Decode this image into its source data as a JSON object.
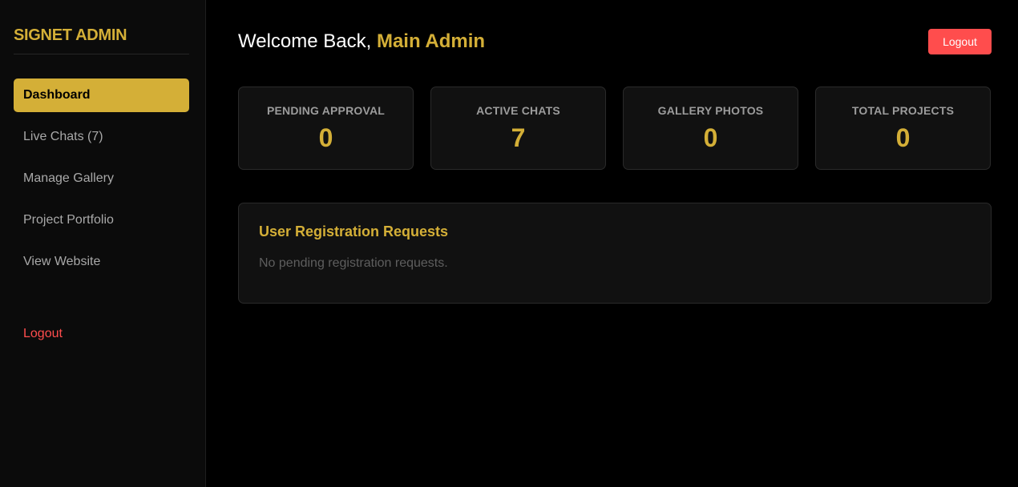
{
  "sidebar": {
    "brand": "SIGNET ADMIN",
    "items": [
      {
        "label": "Dashboard"
      },
      {
        "label": "Live Chats (7)"
      },
      {
        "label": "Manage Gallery"
      },
      {
        "label": "Project Portfolio"
      },
      {
        "label": "View Website"
      }
    ],
    "logout_label": "Logout"
  },
  "header": {
    "welcome_prefix": "Welcome Back,",
    "user_name": "Main Admin",
    "logout_label": "Logout"
  },
  "stats": [
    {
      "label": "PENDING APPROVAL",
      "value": "0"
    },
    {
      "label": "ACTIVE CHATS",
      "value": "7"
    },
    {
      "label": "GALLERY PHOTOS",
      "value": "0"
    },
    {
      "label": "TOTAL PROJECTS",
      "value": "0"
    }
  ],
  "registration": {
    "title": "User Registration Requests",
    "empty_message": "No pending registration requests."
  },
  "colors": {
    "accent": "#d4af37",
    "danger": "#ff4d4d",
    "background": "#000000"
  }
}
